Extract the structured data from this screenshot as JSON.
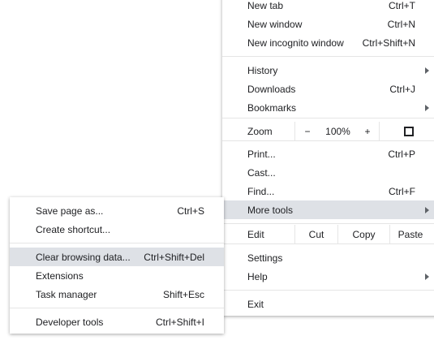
{
  "main_menu": {
    "new_tab": {
      "label": "New tab",
      "shortcut": "Ctrl+T"
    },
    "new_window": {
      "label": "New window",
      "shortcut": "Ctrl+N"
    },
    "new_incognito": {
      "label": "New incognito window",
      "shortcut": "Ctrl+Shift+N"
    },
    "history": {
      "label": "History"
    },
    "downloads": {
      "label": "Downloads",
      "shortcut": "Ctrl+J"
    },
    "bookmarks": {
      "label": "Bookmarks"
    },
    "zoom": {
      "label": "Zoom",
      "minus": "−",
      "value": "100%",
      "plus": "+"
    },
    "print": {
      "label": "Print...",
      "shortcut": "Ctrl+P"
    },
    "cast": {
      "label": "Cast..."
    },
    "find": {
      "label": "Find...",
      "shortcut": "Ctrl+F"
    },
    "more_tools": {
      "label": "More tools"
    },
    "edit": {
      "label": "Edit",
      "cut": "Cut",
      "copy": "Copy",
      "paste": "Paste"
    },
    "settings": {
      "label": "Settings"
    },
    "help": {
      "label": "Help"
    },
    "exit": {
      "label": "Exit"
    }
  },
  "sub_menu": {
    "save_page": {
      "label": "Save page as...",
      "shortcut": "Ctrl+S"
    },
    "create_shortcut": {
      "label": "Create shortcut..."
    },
    "clear_browsing": {
      "label": "Clear browsing data...",
      "shortcut": "Ctrl+Shift+Del"
    },
    "extensions": {
      "label": "Extensions"
    },
    "task_manager": {
      "label": "Task manager",
      "shortcut": "Shift+Esc"
    },
    "developer_tools": {
      "label": "Developer tools",
      "shortcut": "Ctrl+Shift+I"
    }
  },
  "icons": {
    "submenu_arrow": "arrow-right-icon",
    "fullscreen": "fullscreen-icon"
  },
  "colors": {
    "highlight": "#dee1e6",
    "separator": "#e5e5e5",
    "text": "#202124"
  }
}
